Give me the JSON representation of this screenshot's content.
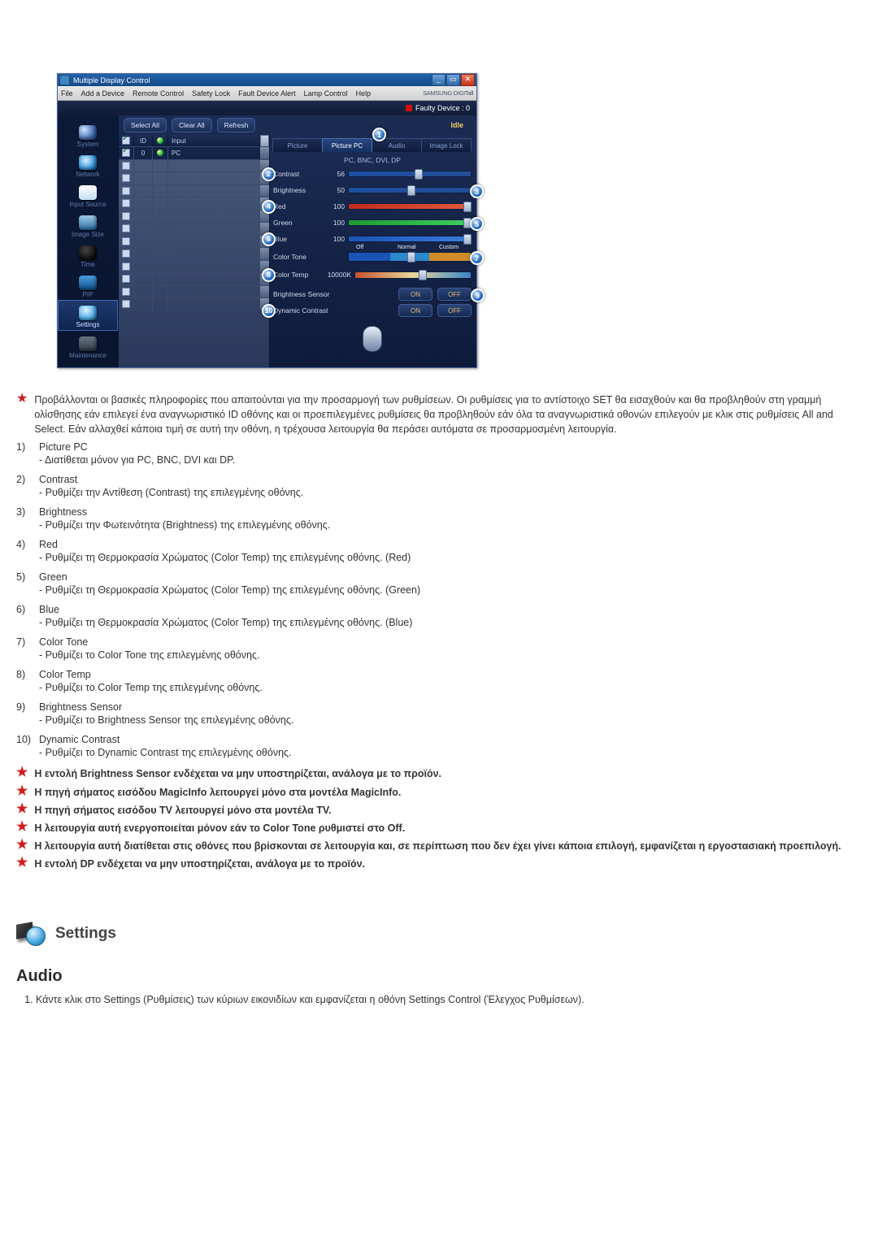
{
  "app": {
    "title": "Multiple Display Control",
    "menubar": [
      "File",
      "Add a Device",
      "Remote Control",
      "Safety Lock",
      "Fault Device Alert",
      "Lamp Control",
      "Help"
    ],
    "brand": "SAMSUNG DIGITall",
    "faulty_label": "Faulty Device : 0",
    "buttons": {
      "select_all": "Select All",
      "clear_all": "Clear All",
      "refresh": "Refresh"
    },
    "idle": "Idle",
    "nav": {
      "system": "System",
      "network": "Network",
      "input_source": "Input Source",
      "image_size": "Image Size",
      "time": "Time",
      "pip": "PIP",
      "settings": "Settings",
      "maintenance": "Maintenance"
    },
    "grid": {
      "head": {
        "checkbox": "",
        "id": "ID",
        "lamp": "",
        "input": "Input"
      },
      "row0": {
        "id": "0",
        "input": "PC"
      }
    },
    "tabs": {
      "picture": "Picture",
      "picture_pc": "Picture PC",
      "audio": "Audio",
      "image_lock": "Image Lock"
    },
    "modes_line": "PC, BNC, DVI, DP",
    "controls": {
      "contrast": {
        "label": "Contrast",
        "value": "56"
      },
      "brightness": {
        "label": "Brightness",
        "value": "50"
      },
      "red": {
        "label": "Red",
        "value": "100"
      },
      "green": {
        "label": "Green",
        "value": "100"
      },
      "blue": {
        "label": "Blue",
        "value": "100"
      },
      "color_tone": {
        "label": "Color Tone",
        "off": "Off",
        "normal": "Normal",
        "custom": "Custom"
      },
      "color_temp": {
        "label": "Color Temp",
        "value": "10000K"
      },
      "brightness_sensor": {
        "label": "Brightness Sensor",
        "on": "ON",
        "off": "OFF"
      },
      "dynamic_contrast": {
        "label": "Dynamic Contrast",
        "on": "ON",
        "off": "OFF"
      }
    },
    "callouts": {
      "c1": "1",
      "c2": "2",
      "c3": "3",
      "c4": "4",
      "c5": "5",
      "c6": "6",
      "c7": "7",
      "c8": "8",
      "c9": "9",
      "c10": "10"
    }
  },
  "doc": {
    "intro_star": "Προβάλλονται οι βασικές πληροφορίες που απαιτούνται για την προσαρμογή των ρυθμίσεων. Οι ρυθμίσεις για το αντίστοιχο SET θα εισαχθούν και θα προβληθούν στη γραμμή ολίσθησης εάν επιλεγεί ένα αναγνωριστικό ID οθόνης και οι προεπιλεγμένες ρυθμίσεις θα προβληθούν εάν όλα τα αναγνωριστικά οθονών επιλεγούν με κλικ στις ρυθμίσεις All and Select. Εάν αλλαχθεί κάποια τιμή σε αυτή την οθόνη, η τρέχουσα λειτουργία θα περάσει αυτόματα σε προσαρμοσμένη λειτουργία.",
    "features": [
      {
        "n": "1)",
        "t": "Picture PC",
        "d": "- Διατίθεται μόνον για PC, BNC, DVI και DP."
      },
      {
        "n": "2)",
        "t": "Contrast",
        "d": "- Ρυθμίζει την Αντίθεση (Contrast) της επιλεγμένης οθόνης."
      },
      {
        "n": "3)",
        "t": "Brightness",
        "d": "- Ρυθμίζει την Φωτεινότητα (Brightness) της επιλεγμένης οθόνης."
      },
      {
        "n": "4)",
        "t": "Red",
        "d": "- Ρυθμίζει τη Θερμοκρασία Χρώματος (Color Temp) της επιλεγμένης οθόνης. (Red)"
      },
      {
        "n": "5)",
        "t": "Green",
        "d": "- Ρυθμίζει τη Θερμοκρασία Χρώματος (Color Temp) της επιλεγμένης οθόνης. (Green)"
      },
      {
        "n": "6)",
        "t": "Blue",
        "d": "- Ρυθμίζει τη Θερμοκρασία Χρώματος (Color Temp) της επιλεγμένης οθόνης. (Blue)"
      },
      {
        "n": "7)",
        "t": "Color Tone",
        "d": "- Ρυθμίζει το Color Tone της επιλεγμένης οθόνης."
      },
      {
        "n": "8)",
        "t": "Color Temp",
        "d": "- Ρυθμίζει το Color Temp της επιλεγμένης οθόνης."
      },
      {
        "n": "9)",
        "t": "Brightness Sensor",
        "d": "- Ρυθμίζει το Brightness Sensor της επιλεγμένης οθόνης."
      },
      {
        "n": "10)",
        "t": "Dynamic Contrast",
        "d": "- Ρυθμίζει το Dynamic Contrast της επιλεγμένης οθόνης."
      }
    ],
    "star_notes": [
      "Η εντολή Brightness Sensor ενδέχεται να μην υποστηρίζεται, ανάλογα με το προϊόν.",
      "Η πηγή σήματος εισόδου MagicInfo λειτουργεί μόνο στα μοντέλα MagicInfo.",
      "Η πηγή σήματος εισόδου TV λειτουργεί μόνο στα μοντέλα TV.",
      "Η λειτουργία αυτή ενεργοποιείται μόνον εάν το Color Tone ρυθμιστεί στο Off.",
      "Η λειτουργία αυτή διατίθεται στις οθόνες που βρίσκονται σε λειτουργία και, σε περίπτωση που δεν έχει γίνει κάποια επιλογή, εμφανίζεται η εργοστασιακή προεπιλογή.",
      "Η εντολή DP ενδέχεται να μην υποστηρίζεται, ανάλογα με το προϊόν."
    ],
    "section_settings": "Settings",
    "audio_h": "Audio",
    "audio_step1": "Κάντε κλικ στο Settings (Ρυθμίσεις) των κύριων εικονιδίων και εμφανίζεται η οθόνη Settings Control (Έλεγχος Ρυθμίσεων)."
  }
}
